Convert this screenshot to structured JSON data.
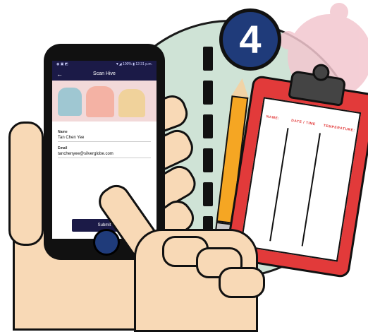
{
  "step": {
    "number": "4"
  },
  "phone": {
    "status": {
      "left": "◉ ▣ ◩",
      "right": "▼◢ 100% ▮ 12:31 p.m."
    },
    "topbar": {
      "title": "Scan Hive",
      "back_icon": "arrow-left-icon"
    },
    "form": {
      "name_label": "Name",
      "name_value": "Tan Chen Yee",
      "email_label": "Email",
      "email_value": "tanchenyee@silverglobe.com",
      "submit_label": "Submit"
    }
  },
  "clipboard": {
    "columns": [
      "NAME:",
      "DATE / TIME",
      "TEMPERATURE:"
    ]
  },
  "colors": {
    "circle": "#cfe3d6",
    "badge": "#1f3b7a",
    "clipboard": "#e23a3a",
    "app_bar": "#1b1a47"
  }
}
